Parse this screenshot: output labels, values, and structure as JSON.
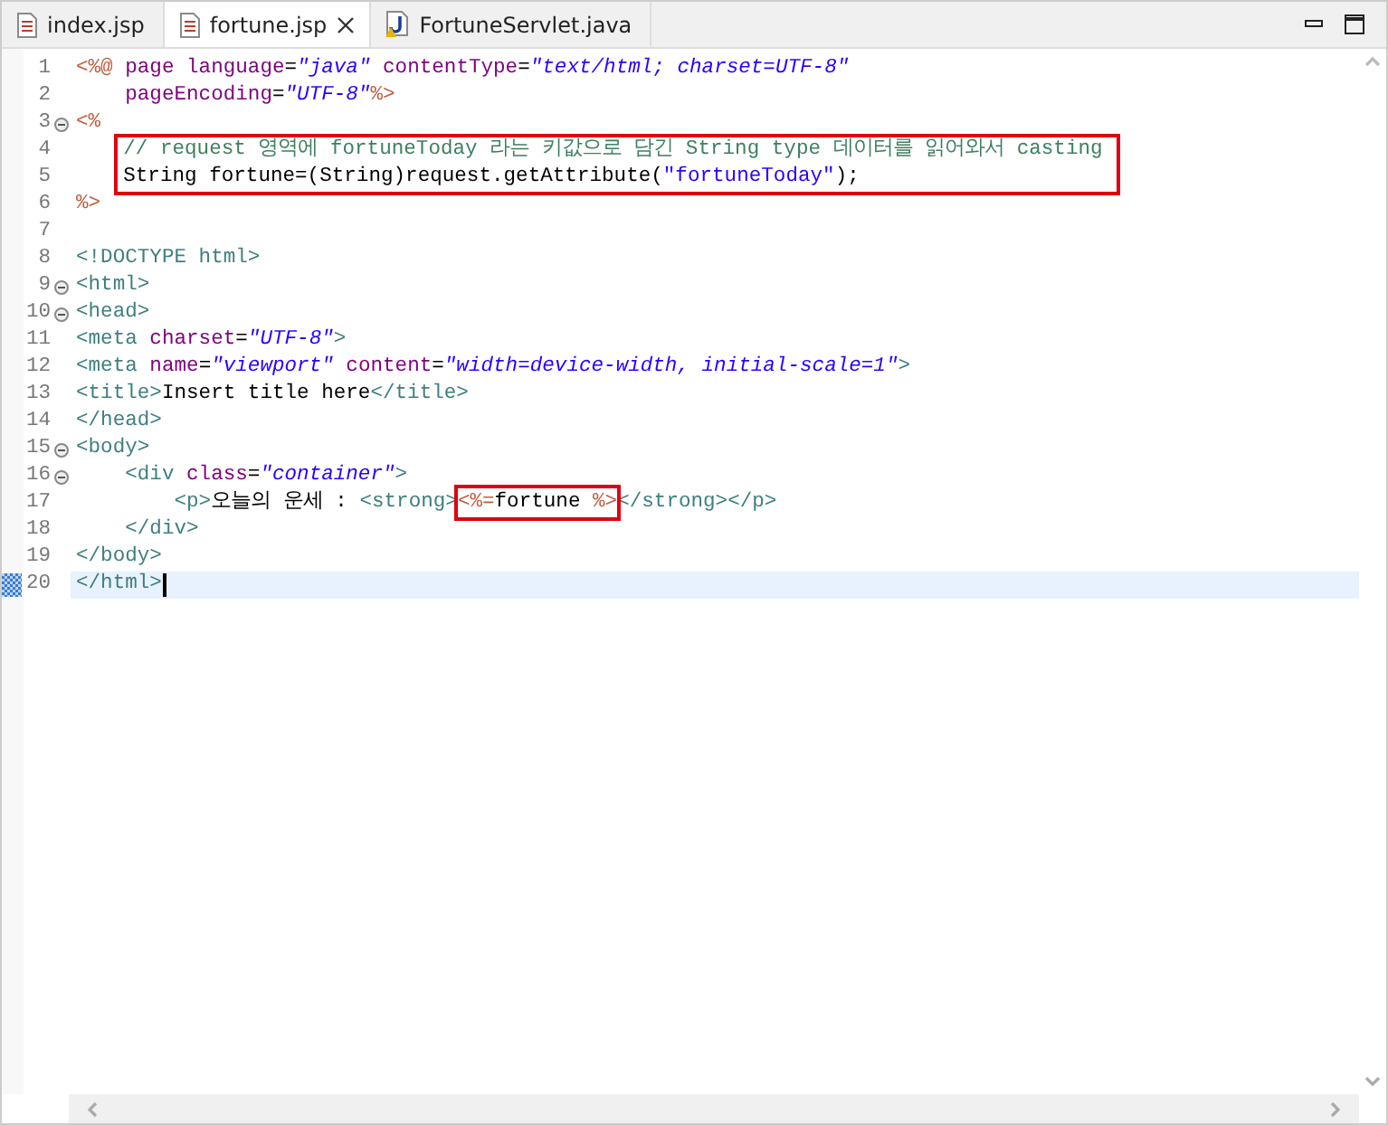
{
  "tabs": [
    {
      "label": "index.jsp",
      "kind": "jsp",
      "selected": false,
      "closable": false
    },
    {
      "label": "fortune.jsp",
      "kind": "jsp",
      "selected": true,
      "closable": true
    },
    {
      "label": "FortuneServlet.java",
      "kind": "java",
      "selected": false,
      "closable": false
    }
  ],
  "editor": {
    "lines": [
      {
        "number": "1",
        "fold": false,
        "current": false,
        "boxed": false,
        "tokens": [
          {
            "kind": "jsp",
            "text": "<%@"
          },
          {
            "kind": "kw",
            "text": " page"
          },
          {
            "kind": "attr",
            "text": " language"
          },
          {
            "kind": "plain",
            "text": "="
          },
          {
            "kind": "val",
            "text": "\"java\""
          },
          {
            "kind": "attr",
            "text": " contentType"
          },
          {
            "kind": "plain",
            "text": "="
          },
          {
            "kind": "val",
            "text": "\"text/html; charset=UTF-8\""
          }
        ]
      },
      {
        "number": "2",
        "fold": false,
        "current": false,
        "boxed": false,
        "tokens": [
          {
            "kind": "attr",
            "text": "    pageEncoding"
          },
          {
            "kind": "plain",
            "text": "="
          },
          {
            "kind": "val",
            "text": "\"UTF-8\""
          },
          {
            "kind": "jsp",
            "text": "%>"
          }
        ]
      },
      {
        "number": "3",
        "fold": true,
        "current": false,
        "boxed": false,
        "tokens": [
          {
            "kind": "jsp",
            "text": "<%"
          }
        ]
      },
      {
        "number": "4",
        "fold": false,
        "current": false,
        "boxed": true,
        "tokens": [
          {
            "kind": "comment",
            "text": "    // request 영역에 fortuneToday 라는 키값으로 담긴 String type 데이터를 읽어와서 casting"
          }
        ]
      },
      {
        "number": "5",
        "fold": false,
        "current": false,
        "boxed": true,
        "tokens": [
          {
            "kind": "plain",
            "text": "    String fortune=(String)request.getAttribute("
          },
          {
            "kind": "str",
            "text": "\"fortuneToday\""
          },
          {
            "kind": "plain",
            "text": ");"
          }
        ]
      },
      {
        "number": "6",
        "fold": false,
        "current": false,
        "boxed": false,
        "tokens": [
          {
            "kind": "jsp",
            "text": "%>"
          }
        ]
      },
      {
        "number": "7",
        "fold": false,
        "current": false,
        "boxed": false
      },
      {
        "number": "8",
        "fold": false,
        "current": false,
        "boxed": false,
        "tokens": [
          {
            "kind": "tag",
            "text": "<!DOCTYPE html>"
          }
        ]
      },
      {
        "number": "9",
        "fold": true,
        "current": false,
        "boxed": false,
        "tokens": [
          {
            "kind": "tag",
            "text": "<html>"
          }
        ]
      },
      {
        "number": "10",
        "fold": true,
        "current": false,
        "boxed": false,
        "tokens": [
          {
            "kind": "tag",
            "text": "<head>"
          }
        ]
      },
      {
        "number": "11",
        "fold": false,
        "current": false,
        "boxed": false,
        "tokens": [
          {
            "kind": "tag",
            "text": "<meta"
          },
          {
            "kind": "attr",
            "text": " charset"
          },
          {
            "kind": "plain",
            "text": "="
          },
          {
            "kind": "val",
            "text": "\"UTF-8\""
          },
          {
            "kind": "tag",
            "text": ">"
          }
        ]
      },
      {
        "number": "12",
        "fold": false,
        "current": false,
        "boxed": false,
        "tokens": [
          {
            "kind": "tag",
            "text": "<meta"
          },
          {
            "kind": "attr",
            "text": " name"
          },
          {
            "kind": "plain",
            "text": "="
          },
          {
            "kind": "val",
            "text": "\"viewport\""
          },
          {
            "kind": "attr",
            "text": " content"
          },
          {
            "kind": "plain",
            "text": "="
          },
          {
            "kind": "val",
            "text": "\"width=device-width, initial-scale=1\""
          },
          {
            "kind": "tag",
            "text": ">"
          }
        ]
      },
      {
        "number": "13",
        "fold": false,
        "current": false,
        "boxed": false,
        "tokens": [
          {
            "kind": "tag",
            "text": "<title>"
          },
          {
            "kind": "plain",
            "text": "Insert title here"
          },
          {
            "kind": "tag",
            "text": "</title>"
          }
        ]
      },
      {
        "number": "14",
        "fold": false,
        "current": false,
        "boxed": false,
        "tokens": [
          {
            "kind": "tag",
            "text": "</head>"
          }
        ]
      },
      {
        "number": "15",
        "fold": true,
        "current": false,
        "boxed": false,
        "tokens": [
          {
            "kind": "tag",
            "text": "<body>"
          }
        ]
      },
      {
        "number": "16",
        "fold": true,
        "current": false,
        "boxed": false,
        "tokens": [
          {
            "kind": "tag",
            "text": "    <div"
          },
          {
            "kind": "attr",
            "text": " class"
          },
          {
            "kind": "plain",
            "text": "="
          },
          {
            "kind": "val",
            "text": "\"container\""
          },
          {
            "kind": "tag",
            "text": ">"
          }
        ]
      },
      {
        "number": "17",
        "fold": false,
        "current": false,
        "boxed": false,
        "tokens": [
          {
            "kind": "tag",
            "text": "        <p>"
          },
          {
            "kind": "plain",
            "text": "오늘의 운세 : "
          },
          {
            "kind": "tag",
            "text": "<strong>"
          },
          {
            "kind": "jsp",
            "text": "<%=",
            "boxed": true
          },
          {
            "kind": "plain",
            "text": "fortune ",
            "boxed": true
          },
          {
            "kind": "jsp",
            "text": "%>",
            "boxed": true
          },
          {
            "kind": "tag",
            "text": "</strong></p>"
          }
        ]
      },
      {
        "number": "18",
        "fold": false,
        "current": false,
        "boxed": false,
        "tokens": [
          {
            "kind": "tag",
            "text": "    </div>"
          }
        ]
      },
      {
        "number": "19",
        "fold": false,
        "current": false,
        "boxed": false,
        "tokens": [
          {
            "kind": "tag",
            "text": "</body>"
          }
        ]
      },
      {
        "number": "20",
        "fold": false,
        "current": true,
        "boxed": false,
        "tokens": [
          {
            "kind": "tag",
            "text": "</html>"
          }
        ]
      }
    ]
  }
}
